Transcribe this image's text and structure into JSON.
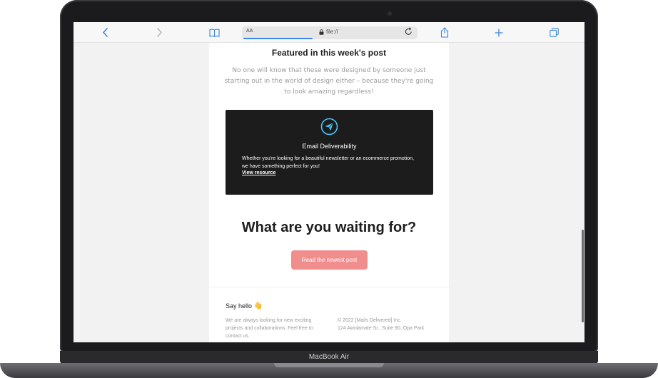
{
  "browser": {
    "address_prefix": "AA",
    "url": "file://",
    "icons": [
      "back-icon",
      "forward-icon",
      "book-icon",
      "lock-icon",
      "reload-icon",
      "share-icon",
      "new-tab-icon",
      "tabs-icon"
    ]
  },
  "email": {
    "featured_title": "Featured in this week's post",
    "featured_description": "No one will know that these were designed by someone just starting out in the world of design either – because they're going to look amazing regardless!",
    "card": {
      "title": "Email Deliverability",
      "text": "Whether you're looking for a beautiful newsletter or an ecommerce promotion, we have something perfect for you!",
      "link": "View resource"
    },
    "cta_heading": "What are you waiting for?",
    "cta_button": "Read the newest post",
    "footer": {
      "say_hello": "Say hello",
      "left_text": "We are always looking for new exciting projects and collaborations. Feel free to contact us.",
      "copyright": "© 2022 [Mails Delivered] Inc.",
      "address": "124 Awolamate Sr., Suite 90, Opa Park"
    }
  },
  "device": {
    "brand": "MacBook Air"
  },
  "colors": {
    "accent": "#3a86e8",
    "cta": "#f08d8d",
    "card_bg": "#1c1c1c",
    "icon_ring": "#4fc3f7"
  }
}
